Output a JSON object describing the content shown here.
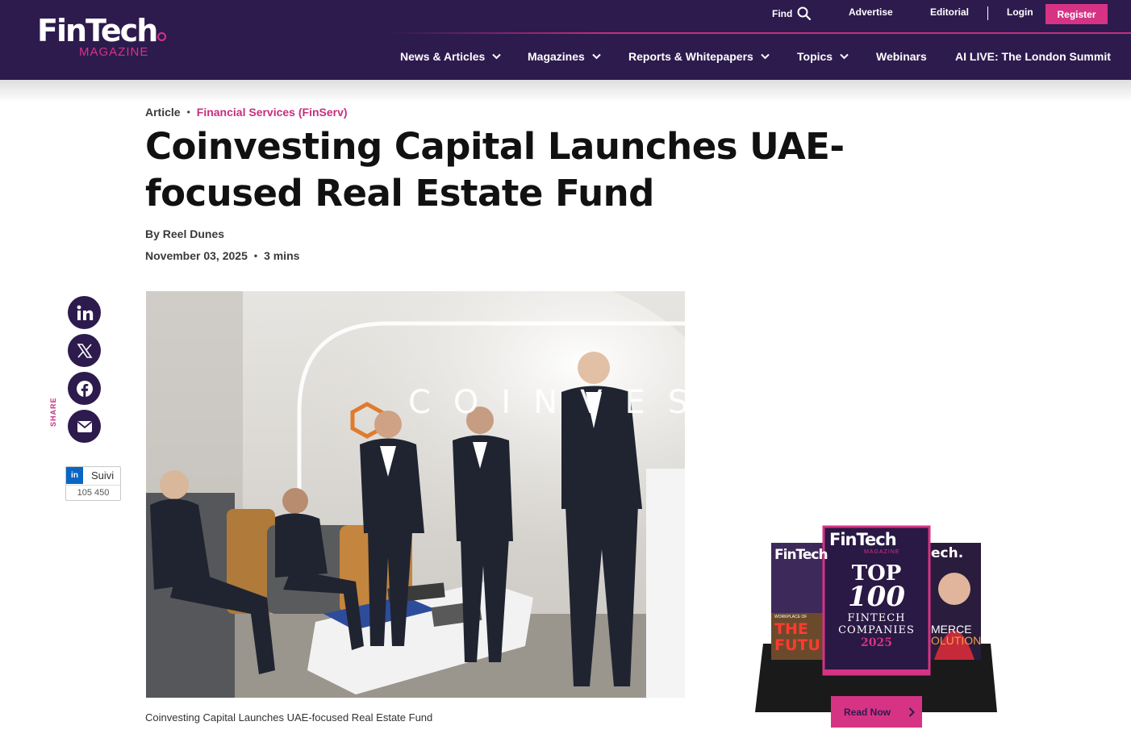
{
  "header": {
    "logo_main": "FinTech",
    "logo_sub": "MAGAZINE",
    "util": {
      "find": "Find",
      "advertise": "Advertise",
      "editorial": "Editorial",
      "login": "Login",
      "register": "Register"
    },
    "nav": [
      "News & Articles",
      "Magazines",
      "Reports & Whitepapers",
      "Topics",
      "Webinars",
      "AI LIVE: The London Summit"
    ]
  },
  "article": {
    "type": "Article",
    "category": "Financial Services (FinServ)",
    "title": "Coinvesting Capital Launches UAE-focused Real Estate Fund",
    "byline": "By Reel Dunes",
    "date": "November 03, 2025",
    "read_time": "3 mins",
    "caption": "Coinvesting Capital Launches UAE-focused Real Estate Fund",
    "image_wall_text": "COINVESTS"
  },
  "share": {
    "label": "SHARE",
    "icons": [
      "linkedin-icon",
      "x-icon",
      "facebook-icon",
      "email-icon"
    ],
    "follow_label": "Suivi",
    "follow_count": "105 450"
  },
  "promo": {
    "cover_logo": "FinTech",
    "cover_sub": "MAGAZINE",
    "cover_line1": "TOP",
    "cover_line2": "100",
    "cover_line3": "FINTECH",
    "cover_line4": "COMPANIES",
    "cover_year": "2025",
    "left_cover_logo": "FinTech",
    "left_cover_headline": "THE FUTU",
    "left_cover_sub": "WORKPLACE OF",
    "right_cover_logo": "ech.",
    "right_cover_headline": "MERCE",
    "right_cover_headline2": "OLUTION",
    "read_now": "Read Now"
  },
  "colors": {
    "header_bg": "#2d1b4e",
    "accent": "#d63384"
  }
}
